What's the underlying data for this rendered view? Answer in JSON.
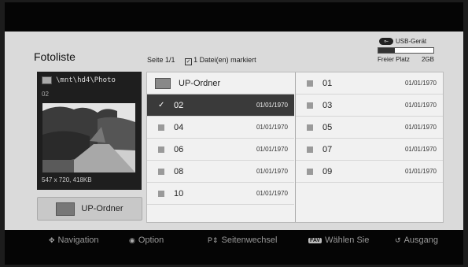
{
  "header": {
    "title": "Fotoliste",
    "page_label": "Seite",
    "page_value": "1/1",
    "marked": "1 Datei(en) markiert"
  },
  "usb": {
    "label": "USB-Gerät",
    "free_label": "Freier Platz",
    "free_value": "2GB",
    "fill_fraction": 0.3
  },
  "preview": {
    "path": "\\mnt\\hd4\\Photo",
    "filename": "02",
    "resolution": "547 x 720, 418KB"
  },
  "up_button": {
    "label": "UP-Ordner"
  },
  "list": {
    "up_label": "UP-Ordner",
    "left": [
      {
        "name": "02",
        "date": "01/01/1970",
        "selected": true
      },
      {
        "name": "04",
        "date": "01/01/1970",
        "selected": false
      },
      {
        "name": "06",
        "date": "01/01/1970",
        "selected": false
      },
      {
        "name": "08",
        "date": "01/01/1970",
        "selected": false
      },
      {
        "name": "10",
        "date": "01/01/1970",
        "selected": false
      }
    ],
    "right": [
      {
        "name": "01",
        "date": "01/01/1970"
      },
      {
        "name": "03",
        "date": "01/01/1970"
      },
      {
        "name": "05",
        "date": "01/01/1970"
      },
      {
        "name": "07",
        "date": "01/01/1970"
      },
      {
        "name": "09",
        "date": "01/01/1970"
      }
    ]
  },
  "footer": {
    "navigation": "Navigation",
    "option": "Option",
    "page_change": "Seitenwechsel",
    "fav_badge": "FAV",
    "select": "Wählen Sie",
    "exit": "Ausgang"
  }
}
